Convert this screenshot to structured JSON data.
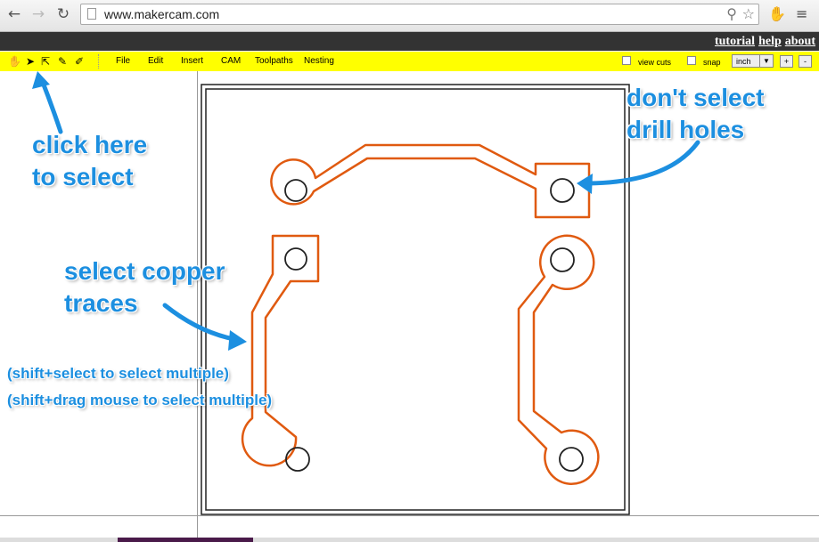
{
  "browser": {
    "url": "www.makercam.com",
    "icons": [
      "back-arrow-icon",
      "forward-arrow-icon",
      "reload-icon",
      "page-icon",
      "zoom-icon",
      "star-icon",
      "extension-icon",
      "menu-icon"
    ]
  },
  "site_header": {
    "links": [
      "tutorial",
      "help",
      "about"
    ]
  },
  "toolbar": {
    "tools": [
      "hand-tool-icon",
      "select-arrow-icon",
      "node-select-icon",
      "pen-icon",
      "eraser-icon"
    ],
    "menu": [
      "File",
      "Edit",
      "Insert",
      "CAM",
      "Toolpaths",
      "Nesting"
    ],
    "view_cuts_label": "view cuts",
    "snap_label": "snap",
    "unit_value": "inch",
    "zoom_in_label": "+",
    "zoom_out_label": "-"
  },
  "annotations": {
    "click_line1": "click here",
    "click_line2": "to select",
    "drill_line1": "don't select",
    "drill_line2": "drill holes",
    "copper_line1": "select copper",
    "copper_line2": "traces",
    "shift_select": "(shift+select to select multiple)",
    "shift_drag": "(shift+drag mouse to select multiple)"
  },
  "colors": {
    "toolbar": "#ffff00",
    "trace": "#e05a10",
    "annotation": "#1c8fe0",
    "header": "#333333"
  }
}
